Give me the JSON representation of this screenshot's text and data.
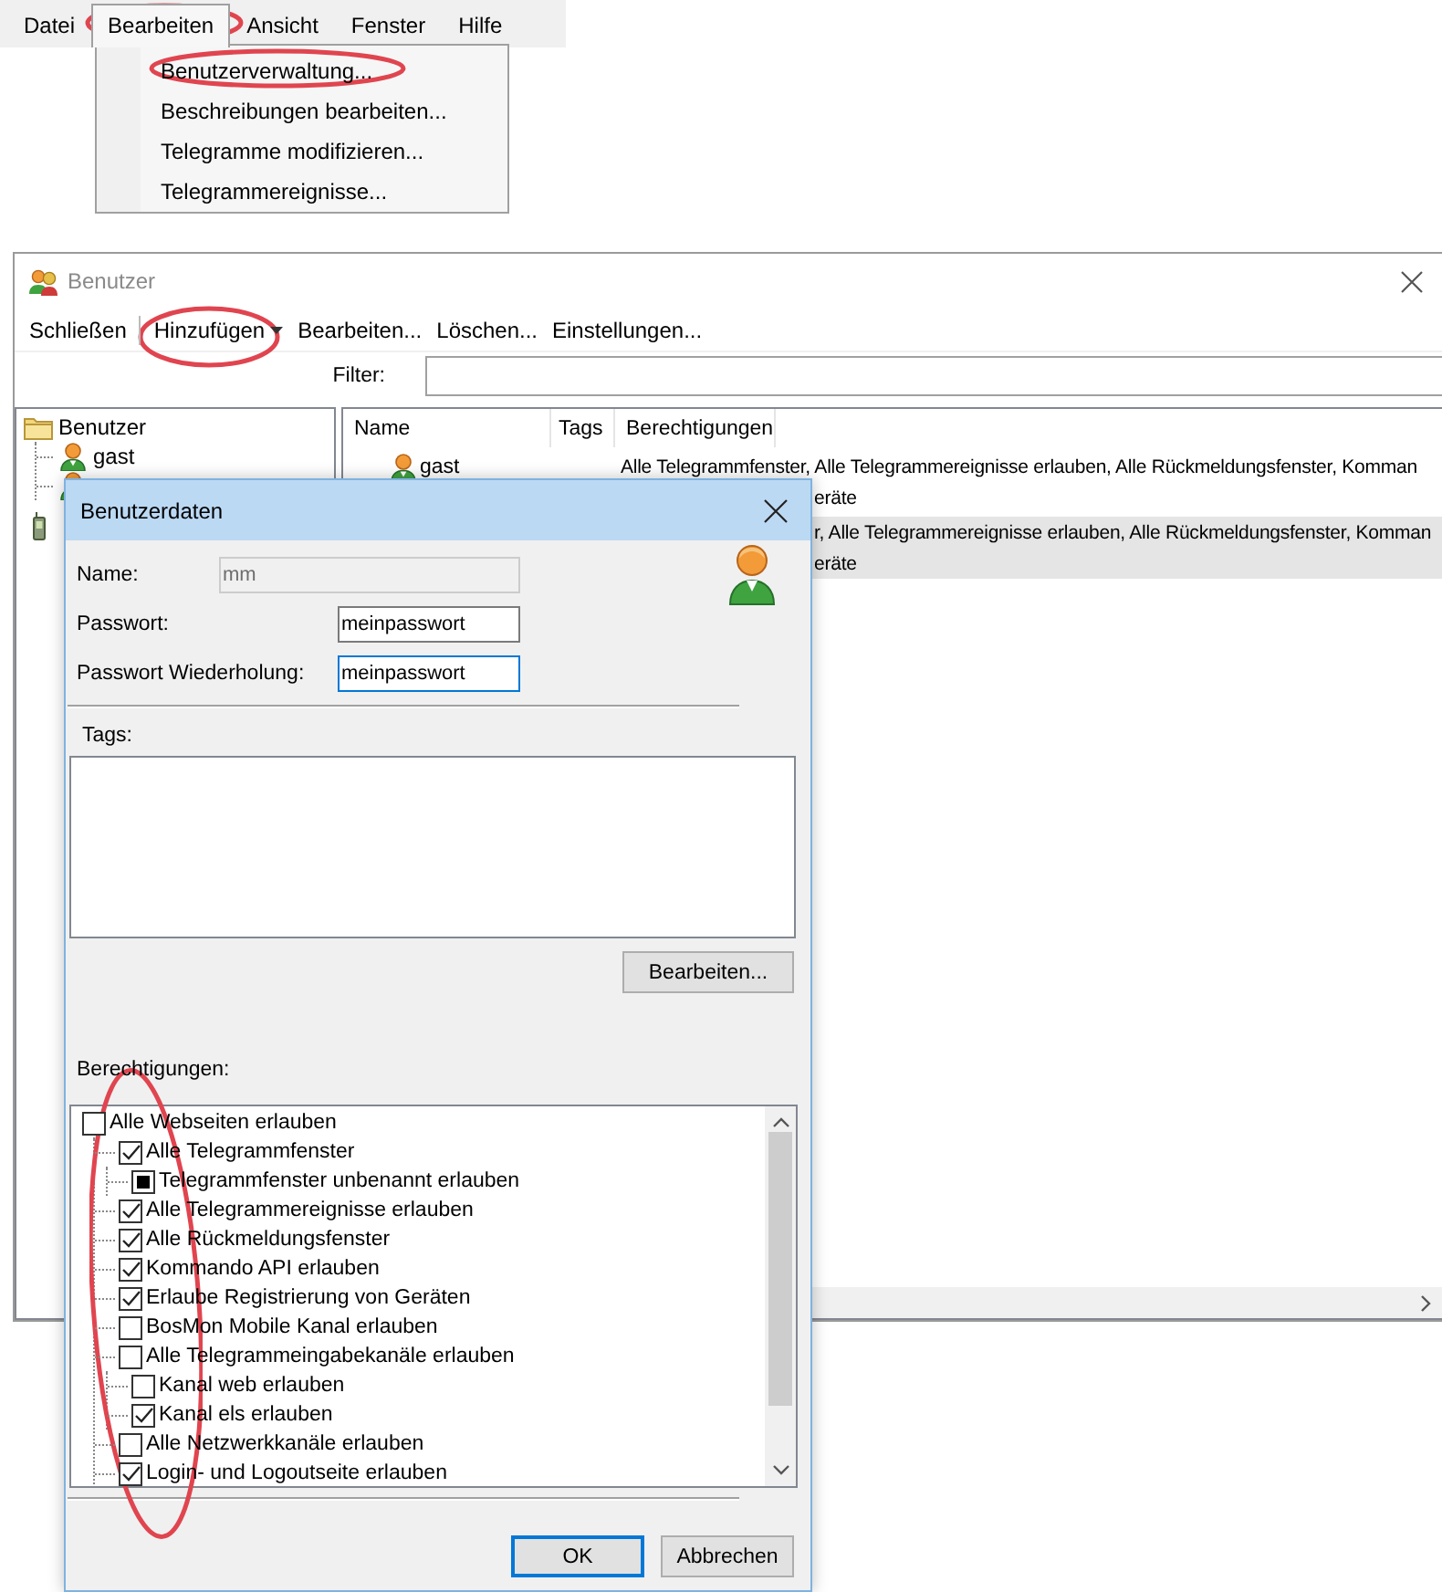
{
  "menu_bar": {
    "items": [
      {
        "label": "Datei",
        "selected": false
      },
      {
        "label": "Bearbeiten",
        "selected": true
      },
      {
        "label": "Ansicht",
        "selected": false
      },
      {
        "label": "Fenster",
        "selected": false
      },
      {
        "label": "Hilfe",
        "selected": false
      }
    ]
  },
  "menu_dropdown": {
    "items": [
      "Benutzerverwaltung...",
      "Beschreibungen bearbeiten...",
      "Telegramme modifizieren...",
      "Telegrammereignisse..."
    ]
  },
  "users_window": {
    "title": "Benutzer",
    "toolbar": [
      {
        "label": "Schließen",
        "kind": "button"
      },
      {
        "label": "Hinzufügen",
        "kind": "dropdown"
      },
      {
        "label": "Bearbeiten...",
        "kind": "button"
      },
      {
        "label": "Löschen...",
        "kind": "button"
      },
      {
        "label": "Einstellungen...",
        "kind": "button"
      }
    ],
    "filter_label": "Filter:",
    "tree": {
      "items": [
        {
          "label": "Benutzer",
          "kind": "folder",
          "children": [
            {
              "label": "gast",
              "kind": "user"
            },
            {
              "kind": "user"
            }
          ]
        },
        {
          "kind": "device"
        }
      ]
    },
    "table": {
      "columns": [
        "Name",
        "Tags",
        "Berechtigungen"
      ],
      "rows": [
        {
          "name": "gast",
          "lines": [
            "Alle Telegrammfenster, Alle Telegrammereignisse erlauben, Alle Rückmeldungsfenster, Komman",
            "eräte"
          ],
          "selected": false
        },
        {
          "lines": [
            "r, Alle Telegrammereignisse erlauben, Alle Rückmeldungsfenster, Komman",
            "eräte"
          ],
          "selected": true
        }
      ]
    }
  },
  "user_dialog": {
    "title": "Benutzerdaten",
    "fields": [
      {
        "label": "Name:",
        "value": "mm",
        "kind": "text",
        "disabled": true,
        "focused": false
      },
      {
        "label": "Passwort:",
        "value": "meinpasswort",
        "kind": "password",
        "disabled": false,
        "focused": false
      },
      {
        "label": "Passwort Wiederholung:",
        "value": "meinpasswort",
        "kind": "password",
        "disabled": false,
        "focused": true
      }
    ],
    "tags_label": "Tags:",
    "tags_button": "Bearbeiten...",
    "permissions_label": "Berechtigungen:",
    "permissions": [
      {
        "label": "Alle Webseiten erlauben",
        "checked": false,
        "partial": false,
        "children": [
          {
            "label": "Alle Telegrammfenster",
            "checked": true,
            "partial": false,
            "children": [
              {
                "label": "Telegrammfenster unbenannt erlauben",
                "checked": false,
                "partial": true
              }
            ]
          },
          {
            "label": "Alle Telegrammereignisse erlauben",
            "checked": true,
            "partial": false
          },
          {
            "label": "Alle Rückmeldungsfenster",
            "checked": true,
            "partial": false
          },
          {
            "label": "Kommando API erlauben",
            "checked": true,
            "partial": false
          },
          {
            "label": "Erlaube Registrierung von Geräten",
            "checked": true,
            "partial": false
          },
          {
            "label": "BosMon Mobile Kanal erlauben",
            "checked": false,
            "partial": false
          },
          {
            "label": "Alle Telegrammeingabekanäle erlauben",
            "checked": false,
            "partial": false,
            "children": [
              {
                "label": "Kanal web erlauben",
                "checked": false,
                "partial": false
              },
              {
                "label": "Kanal els erlauben",
                "checked": true,
                "partial": false
              }
            ]
          },
          {
            "label": "Alle Netzwerkkanäle erlauben",
            "checked": false,
            "partial": false
          },
          {
            "label": "Login- und Logoutseite erlauben",
            "checked": true,
            "partial": false
          }
        ]
      }
    ],
    "buttons": [
      {
        "label": "OK",
        "default": true
      },
      {
        "label": "Abbrechen",
        "default": false
      }
    ]
  }
}
